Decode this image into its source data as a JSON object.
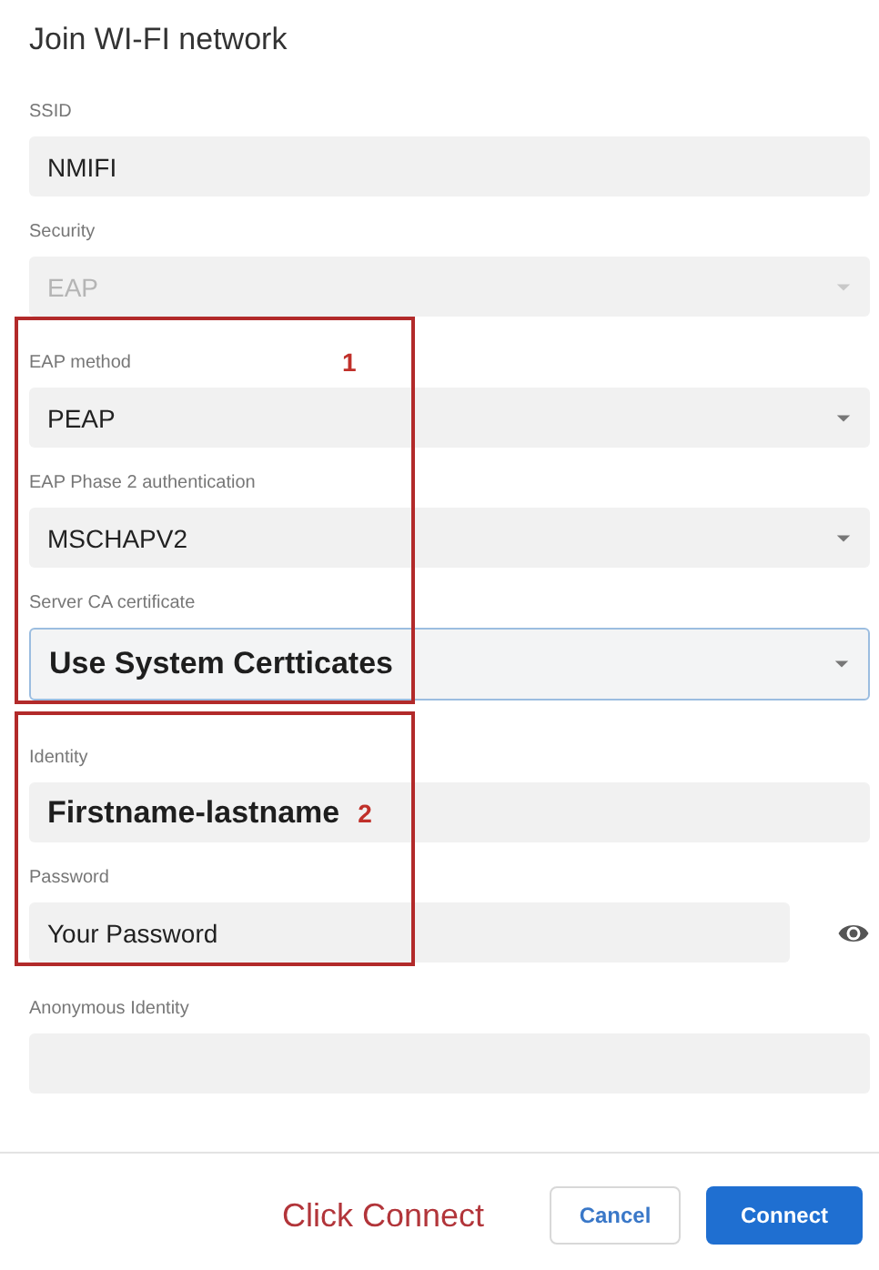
{
  "title": "Join WI-FI network",
  "groups": [
    {
      "fields": [
        {
          "kind": "text",
          "label": "SSID",
          "value": "NMIFI"
        },
        {
          "kind": "select",
          "label": "Security",
          "value": "EAP",
          "disabled": true
        }
      ]
    },
    {
      "marker": "1",
      "fields": [
        {
          "kind": "select",
          "label": "EAP method",
          "value": "PEAP"
        },
        {
          "kind": "select",
          "label": "EAP Phase 2 authentication",
          "value": "MSCHAPV2"
        },
        {
          "kind": "select",
          "label": "Server CA certificate",
          "value": "Use System Certticates",
          "focused": true,
          "emphasized": true
        }
      ]
    },
    {
      "marker": "2",
      "fields": [
        {
          "kind": "text",
          "label": "Identity",
          "value": "Firstname-lastname",
          "emphasized": true
        },
        {
          "kind": "password",
          "label": "Password",
          "value": "Your Password"
        }
      ]
    },
    {
      "fields": [
        {
          "kind": "text",
          "label": "Anonymous Identity"
        }
      ]
    }
  ],
  "instruction": "Click Connect",
  "buttons": [
    {
      "kind": "secondary",
      "label": "Cancel"
    },
    {
      "kind": "primary",
      "label": "Connect"
    }
  ]
}
